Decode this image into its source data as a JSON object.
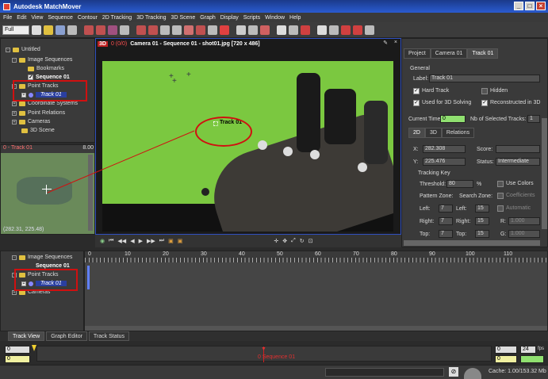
{
  "window": {
    "title": "Autodesk MatchMover",
    "min": "_",
    "max": "□",
    "close": "×"
  },
  "menu": [
    "File",
    "Edit",
    "View",
    "Sequence",
    "Contour",
    "2D Tracking",
    "3D Tracking",
    "3D Scene",
    "Graph",
    "Display",
    "Scripts",
    "Window",
    "Help"
  ],
  "toolbar": {
    "layout_select": "Full"
  },
  "tree": {
    "root": "Untitled",
    "image_sequences": "Image Sequences",
    "bookmarks": "Bookmarks",
    "sequence": "Sequence 01",
    "point_tracks": "Point Tracks",
    "track": "Track 01",
    "coordinate_systems": "Coordinate Systems",
    "point_relations": "Point Relations",
    "cameras": "Cameras",
    "scene": "3D Scene"
  },
  "zoom": {
    "title": "0 - Track 01",
    "value": "8.00",
    "coords": "(282.31, 225.48)"
  },
  "viewport": {
    "badge": "3D",
    "frame": "0 (0/0)",
    "title": "Camera 01 - Sequence 01 - shot01.jpg [720 x 486]",
    "track_label": "Track 01"
  },
  "right_tabs": [
    "Project",
    "Camera 01",
    "Track 01"
  ],
  "props": {
    "general_title": "General",
    "label_caption": "Label:",
    "label_value": "Track 01",
    "hard_track": "Hard Track",
    "hidden": "Hidden",
    "used_3d": "Used for 3D Solving",
    "reconstructed": "Reconstructed in 3D",
    "current_time_caption": "Current Time:",
    "current_time": "0",
    "nb_selected_caption": "Nb of Selected Tracks:",
    "nb_selected": "1",
    "sub_tabs": [
      "2D",
      "3D",
      "Relations"
    ],
    "x_caption": "X:",
    "x_value": "282.308",
    "y_caption": "Y:",
    "y_value": "225.476",
    "score_caption": "Score:",
    "score_value": "",
    "status_caption": "Status:",
    "status_value": "Intermediate",
    "tracking_key": "Tracking Key",
    "threshold_caption": "Threshold:",
    "threshold_value": "80",
    "threshold_unit": "%",
    "use_colors": "Use Colors",
    "pattern_zone": "Pattern Zone:",
    "search_zone": "Search Zone:",
    "coefficients": "Coefficients",
    "automatic": "Automatic",
    "left_caption": "Left:",
    "right_caption": "Right:",
    "top_caption": "Top:",
    "pattern_left": "7",
    "pattern_right": "7",
    "pattern_top": "7",
    "search_left": "15",
    "search_right": "15",
    "search_top": "15",
    "r_caption": "R:",
    "g_caption": "G:",
    "r_value": "1.000",
    "g_value": "1.000"
  },
  "timeline": {
    "tree": {
      "image_sequences": "Image Sequences",
      "sequence": "Sequence 01",
      "point_tracks": "Point Tracks",
      "track": "Track 01",
      "cameras": "Cameras"
    },
    "ruler": [
      "0",
      "10",
      "20",
      "30",
      "40",
      "50",
      "60",
      "70",
      "80",
      "90",
      "100",
      "110"
    ],
    "tabs": [
      "Track View",
      "Graph Editor",
      "Track Status"
    ]
  },
  "bottom": {
    "start": "0",
    "end": "0",
    "start2": "0",
    "end2": "0",
    "fps": "24",
    "fps_unit": "fps",
    "playhead": "0 Sequence 01",
    "cache": "Cache: 1.00/153.32 Mb"
  },
  "colors": {
    "accent": "#2a3fa0",
    "highlight": "#d01010",
    "green": "#8fd060"
  }
}
